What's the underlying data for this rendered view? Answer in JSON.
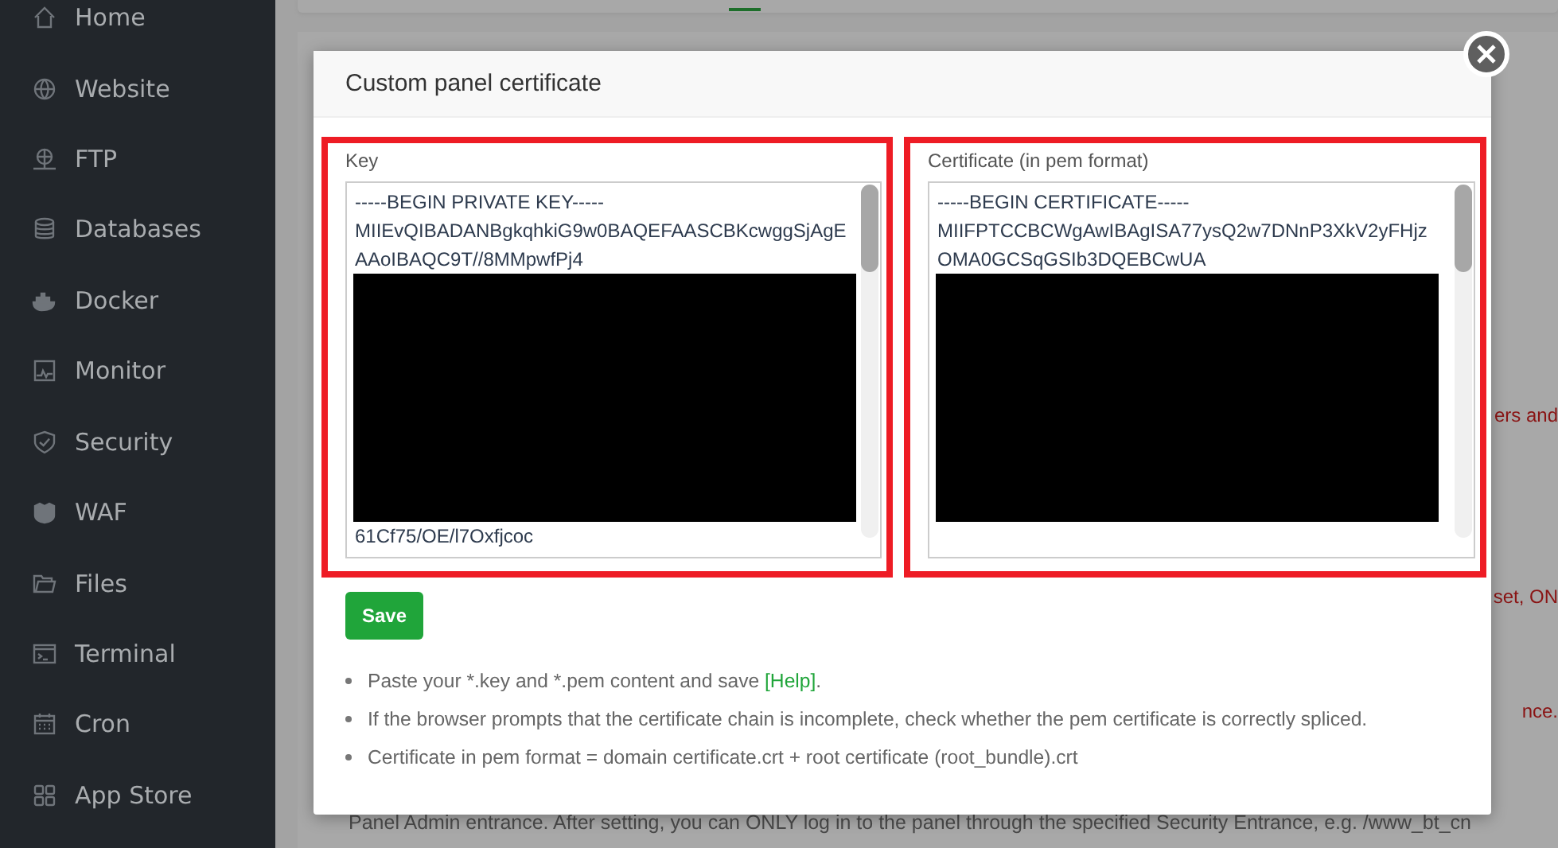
{
  "sidebar": {
    "items": [
      {
        "label": "Home"
      },
      {
        "label": "Website"
      },
      {
        "label": "FTP"
      },
      {
        "label": "Databases"
      },
      {
        "label": "Docker"
      },
      {
        "label": "Monitor"
      },
      {
        "label": "Security"
      },
      {
        "label": "WAF"
      },
      {
        "label": "Files"
      },
      {
        "label": "Terminal"
      },
      {
        "label": "Cron"
      },
      {
        "label": "App Store"
      }
    ]
  },
  "background": {
    "fragments": [
      "ers and",
      "set, ON",
      "nce."
    ],
    "footer_text": "Panel Admin entrance. After setting, you can ONLY log in to the panel through the specified Security Entrance, e.g. /www_bt_cn"
  },
  "dialog": {
    "title": "Custom panel certificate",
    "fields": [
      {
        "label": "Key",
        "lines_before": [
          "-----BEGIN PRIVATE KEY-----",
          "MIIEvQIBADANBgkqhkiG9w0BAQEFAASCBKcwggSjAgE",
          "AAoIBAQC9T//8MMpwfPj4"
        ],
        "lines_after": [
          "61Cf75/OE/l7Oxfjcoc"
        ]
      },
      {
        "label": "Certificate (in pem format)",
        "lines_before": [
          "-----BEGIN CERTIFICATE-----",
          "MIIFPTCCBCWgAwIBAgISA77ysQ2w7DNnP3XkV2yFHjz",
          "OMA0GCSqGSIb3DQEBCwUA"
        ]
      }
    ],
    "save_button": "Save",
    "notes": [
      {
        "text": "Paste your *.key and *.pem content and save ",
        "link": "[Help]",
        "tail": "."
      },
      {
        "text": "If the browser prompts that the certificate chain is incomplete, check whether the pem certificate is correctly spliced."
      },
      {
        "text": "Certificate in pem format = domain certificate.crt + root certificate (root_bundle).crt"
      }
    ]
  }
}
